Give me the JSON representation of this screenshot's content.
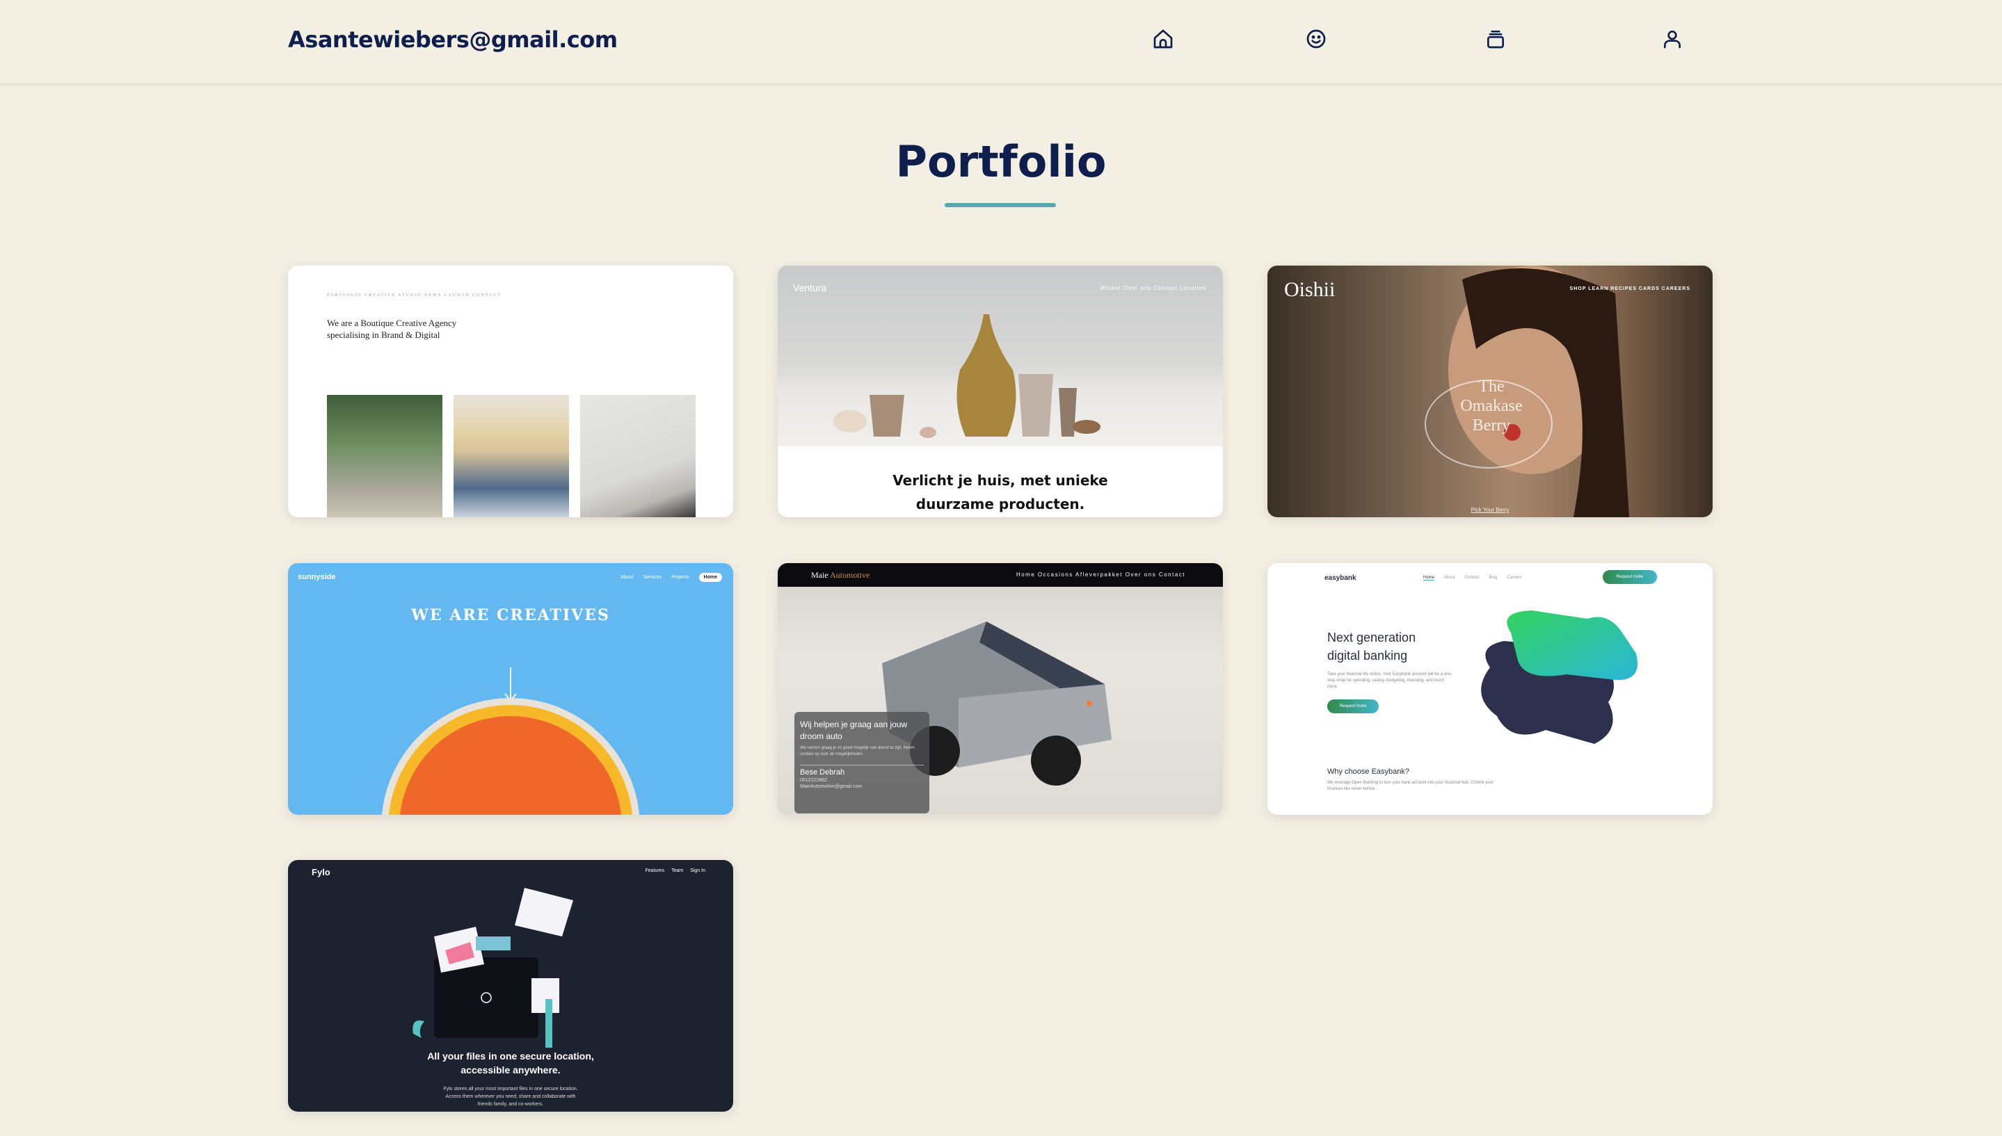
{
  "header": {
    "brand": "Asantewiebers@gmail.com",
    "icons": [
      "home-icon",
      "smile-icon",
      "stack-icon",
      "user-icon"
    ]
  },
  "page": {
    "title": "Portfolio"
  },
  "cards": {
    "c1": {
      "nav": "PORTFOLIO  CREATIVE STUDIO  NEWS  LAUNCH  CONTACT",
      "headline": "We are a Boutique Creative Agency specialising in Brand & Digital"
    },
    "c2": {
      "logo": "Ventura",
      "links": "Winkel   Over ons   Contact   Locaties",
      "tagline_1": "Verlicht je huis, met unieke",
      "tagline_2": "duurzame producten."
    },
    "c3": {
      "logo": "Oishii",
      "links": "SHOP   LEARN   RECIPES   CARDS   CAREERS",
      "center_1": "The",
      "center_2": "Omakase",
      "center_3": "Berry",
      "cta": "Pick Your Berry"
    },
    "c4": {
      "logo": "sunnyside",
      "link_about": "About",
      "link_services": "Services",
      "link_projects": "Projects",
      "link_home": "Home",
      "headline": "WE ARE CREATIVES"
    },
    "c5": {
      "logo_a": "Maie",
      "logo_b": "Automotive",
      "links": "Home  Occasions  Afleverpakket  Over ons  Contact",
      "panel_heading": "Wij helpen je graag aan jouw droom auto",
      "panel_text": "We nemen graag je zo goed mogelijk van dienst te zijn. Neem contact op voor de mogelijkheden.",
      "contact_name": "Bese Debrah",
      "contact_phone": "0612222882",
      "contact_email": "MaieAutomotive@gmail.com"
    },
    "c6": {
      "logo": "easybank",
      "link_home": "Home",
      "link_about": "About",
      "link_contact": "Contact",
      "link_blog": "Blog",
      "link_careers": "Careers",
      "request": "Request Invite",
      "headline_1": "Next generation",
      "headline_2": "digital banking",
      "text": "Take your financial life online. Your Easybank account will be a one-stop-shop for spending, saving, budgeting, investing, and much more.",
      "button": "Request Invite",
      "why_heading": "Why choose Easybank?",
      "why_text": "We leverage Open Banking to turn your bank account into your financial hub. Control your finances like never before."
    },
    "c7": {
      "logo": "Fylo",
      "link_features": "Features",
      "link_team": "Team",
      "link_signin": "Sign In",
      "headline_1": "All your files in one secure location,",
      "headline_2": "accessible anywhere.",
      "text": "Fylo stores all your most important files in one secure location. Access them wherever you need, share and collaborate with friends family, and co-workers."
    }
  },
  "colors": {
    "background": "#f3efe3",
    "navy": "#0e1f4d",
    "accent": "#5aa6ad"
  }
}
